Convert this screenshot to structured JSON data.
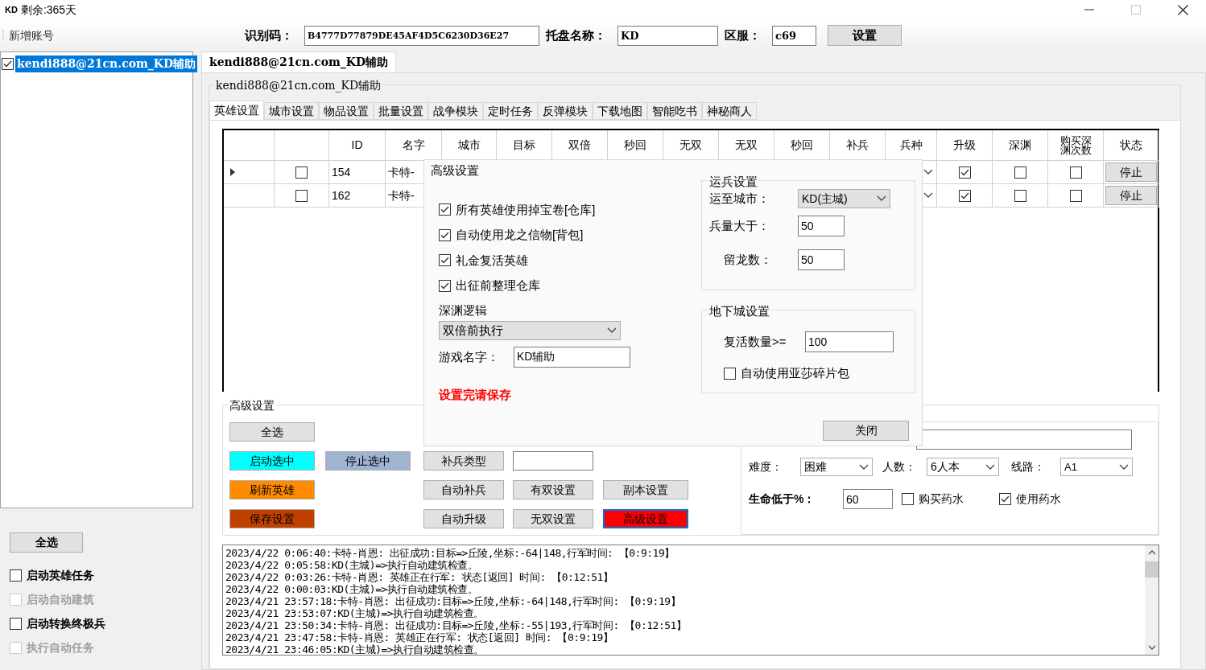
{
  "window": {
    "badge": "KD",
    "title": "剩余:365天"
  },
  "toolbar": {
    "add_account": "新增账号",
    "fields": [
      {
        "label": "识别码：",
        "value": "B4777D77879DE45AF4D5C6230D36E27"
      },
      {
        "label": "托盘名称：",
        "value": "KD"
      },
      {
        "label": "区服：",
        "value": "c69"
      }
    ],
    "button": "设置"
  },
  "accounts": [
    {
      "label": "kendi888@21cn.com_KD辅助",
      "checked": true,
      "selected": true
    }
  ],
  "sidebar": {
    "select_all": "全选",
    "options": [
      {
        "label": "启动英雄任务",
        "checked": false,
        "disabled": false
      },
      {
        "label": "启动自动建筑",
        "checked": false,
        "disabled": true
      },
      {
        "label": "启动转换终极兵",
        "checked": false,
        "disabled": false
      },
      {
        "label": "执行自动任务",
        "checked": false,
        "disabled": true
      }
    ]
  },
  "account_tab": {
    "label": "kendi888@21cn.com_KD辅助",
    "selected": true
  },
  "group_title": "kendi888@21cn.com_KD辅助",
  "tabs": [
    {
      "label": "英雄设置",
      "selected": true
    },
    {
      "label": "城市设置",
      "selected": false
    },
    {
      "label": "物品设置",
      "selected": false
    },
    {
      "label": "批量设置",
      "selected": false
    },
    {
      "label": "战争模块",
      "selected": false
    },
    {
      "label": "定时任务",
      "selected": false
    },
    {
      "label": "反弹模块",
      "selected": false
    },
    {
      "label": "下载地图",
      "selected": false
    },
    {
      "label": "智能吃书",
      "selected": false
    },
    {
      "label": "神秘商人",
      "selected": false
    }
  ],
  "table": {
    "columns": [
      "ID",
      "名字",
      "城市",
      "目标",
      "双倍",
      "秒回",
      "无双",
      "无双",
      "秒回",
      "补兵",
      "兵种",
      "升级",
      "深渊",
      "购买深渊次数",
      "状态"
    ],
    "rows": [
      {
        "selected": true,
        "checked": false,
        "id": "154",
        "name": "卡特-",
        "upgrade": true,
        "abyss": false,
        "buy_abyss": false,
        "status": "停止"
      },
      {
        "selected": false,
        "checked": false,
        "id": "162",
        "name": "卡特-",
        "upgrade": true,
        "abyss": false,
        "buy_abyss": false,
        "status": "停止"
      }
    ]
  },
  "advanced": {
    "title": "高级设置",
    "left_buttons": [
      {
        "label": "全选",
        "color": "#e1e1e1"
      },
      {
        "label": "启动选中",
        "color": "#00ffff"
      },
      {
        "label": "刷新英雄",
        "color": "#ff8c00"
      },
      {
        "label": "保存设置",
        "color": "#c04000"
      }
    ],
    "stop_button": {
      "label": "停止选中",
      "color": "#a0b4d2"
    },
    "col3": [
      {
        "label": "补兵类型",
        "color": "#e1e1e1",
        "focused": false
      },
      {
        "label": "自动补兵",
        "color": "#e1e1e1",
        "focused": false
      },
      {
        "label": "自动升级",
        "color": "#e1e1e1",
        "focused": false
      }
    ],
    "col4": [
      {
        "label": "有双设置",
        "color": "#e1e1e1",
        "focused": false
      },
      {
        "label": "无双设置",
        "color": "#e1e1e1",
        "focused": false
      }
    ],
    "col5": [
      {
        "label": "副本设置",
        "color": "#e1e1e1",
        "focused": false
      },
      {
        "label": "高级设置",
        "color": "#ff0000",
        "focused": true
      }
    ],
    "dungeon": {
      "difficulty_label": "难度：",
      "difficulty": "困难",
      "players_label": "人数：",
      "players": "6人本",
      "route_label": "线路：",
      "route": "A1",
      "hp_label": "生命低于%：",
      "hp": "60",
      "buy_potion": {
        "label": "购买药水",
        "checked": false
      },
      "use_potion": {
        "label": "使用药水",
        "checked": true
      }
    }
  },
  "log": [
    "2023/4/22 0:06:40:卡特-肖恩: 出征成功:目标=>丘陵,坐标:-64|148,行军时间: 【0:9:19】",
    "2023/4/22 0:05:58:KD(主城)=>执行自动建筑检查。",
    "2023/4/22 0:03:26:卡特-肖恩: 英雄正在行军: 状态[返回] 时间: 【0:12:51】",
    "2023/4/22 0:00:03:KD(主城)=>执行自动建筑检查。",
    "2023/4/21 23:57:18:卡特-肖恩: 出征成功:目标=>丘陵,坐标:-64|148,行军时间: 【0:9:19】",
    "2023/4/21 23:53:07:KD(主城)=>执行自动建筑检查。",
    "2023/4/21 23:50:34:卡特-肖恩: 出征成功:目标=>丘陵,坐标:-55|193,行军时间: 【0:12:51】",
    "2023/4/21 23:47:58:卡特-肖恩: 英雄正在行军: 状态[返回] 时间: 【0:9:19】",
    "2023/4/21 23:46:05:KD(主城)=>执行自动建筑检查。"
  ],
  "dialog": {
    "title": "高级设置",
    "checks": [
      {
        "label": "所有英雄使用掉宝卷[仓库]",
        "checked": true
      },
      {
        "label": "自动使用龙之信物[背包]",
        "checked": true
      },
      {
        "label": "礼金复活英雄",
        "checked": true
      },
      {
        "label": "出征前整理仓库",
        "checked": true
      }
    ],
    "abyss_label": "深渊逻辑",
    "abyss_value": "双倍前执行",
    "game_name_label": "游戏名字：",
    "game_name": "KD辅助",
    "warning": "设置完请保存",
    "transport": {
      "title": "运兵设置",
      "city_label": "运至城市：",
      "city": "KD(主城)",
      "troops_label": "兵量大于：",
      "troops": "50",
      "dragons_label": "留龙数：",
      "dragons": "50"
    },
    "dungeon": {
      "title": "地下城设置",
      "revive_label": "复活数量>=",
      "revive": "100",
      "shard": {
        "label": "自动使用亚莎碎片包",
        "checked": false
      }
    },
    "close": "关闭"
  }
}
